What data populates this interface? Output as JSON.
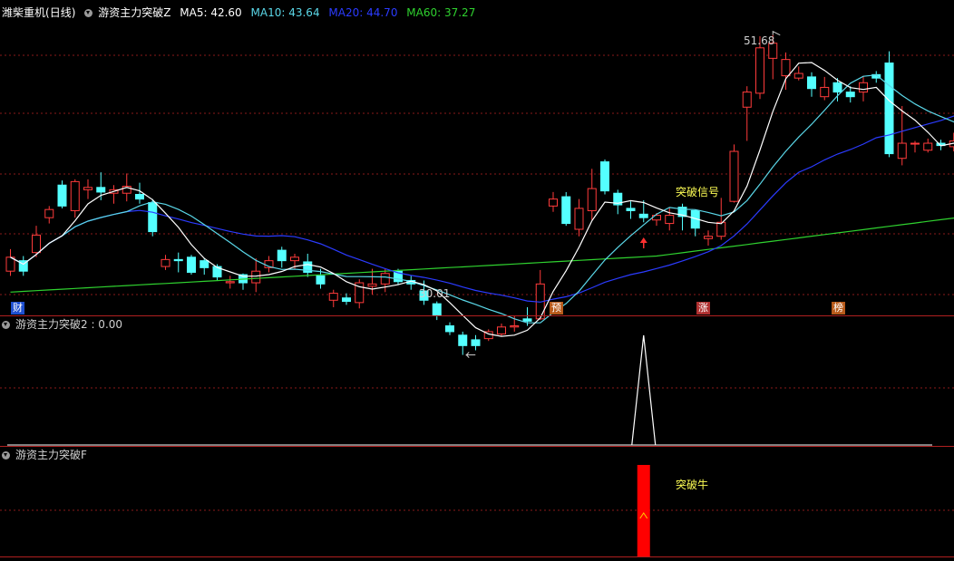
{
  "main_panel": {
    "stock": "潍柴重机",
    "period": "(日线)",
    "indicator": "游资主力突破Z",
    "ma": [
      {
        "label": "MA5: 42.60",
        "color": "#ffffff"
      },
      {
        "label": "MA10: 43.64",
        "color": "#5ad7e8"
      },
      {
        "label": "MA20: 44.70",
        "color": "#2b3bff"
      },
      {
        "label": "MA60: 37.27",
        "color": "#2fd12f"
      }
    ],
    "high_label": "51.68",
    "low_label": "30.01",
    "signal_label": "突破信号",
    "event_tags": [
      {
        "text": "财",
        "color": "#1e4fd0"
      },
      {
        "text": "预",
        "color": "#b85a1a"
      },
      {
        "text": "涨",
        "color": "#b03030"
      },
      {
        "text": "榜",
        "color": "#b85a1a"
      }
    ]
  },
  "sub_panel_1": {
    "title": "游资主力突破2 : 0.00"
  },
  "sub_panel_2": {
    "title": "游资主力突破F",
    "bull_label": "突破牛"
  },
  "colors": {
    "up": "#ff3b3b",
    "down": "#54ffff",
    "grid": "#8a1a1a"
  },
  "chart_data": {
    "type": "candlestick",
    "series": [
      {
        "name": "MA5",
        "values_note": "derived from candles"
      },
      {
        "name": "MA10"
      },
      {
        "name": "MA20"
      },
      {
        "name": "MA60"
      }
    ],
    "candles": [
      [
        31.4,
        32.6,
        33.3,
        31.0
      ],
      [
        32.3,
        31.4,
        32.7,
        31.0
      ],
      [
        33.0,
        34.5,
        35.3,
        32.6
      ],
      [
        36.0,
        36.7,
        37.0,
        35.5
      ],
      [
        38.8,
        37.0,
        39.2,
        36.8
      ],
      [
        36.6,
        39.1,
        39.3,
        36.0
      ],
      [
        38.4,
        38.6,
        39.3,
        37.6
      ],
      [
        38.6,
        38.2,
        39.9,
        37.5
      ],
      [
        38.1,
        38.4,
        38.8,
        37.2
      ],
      [
        38.1,
        38.7,
        39.8,
        37.4
      ],
      [
        38.0,
        37.6,
        39.0,
        37.2
      ],
      [
        37.3,
        34.8,
        37.6,
        34.4
      ],
      [
        31.8,
        32.4,
        32.8,
        31.5
      ],
      [
        32.4,
        32.3,
        33.0,
        31.3
      ],
      [
        32.6,
        31.3,
        32.8,
        31.1
      ],
      [
        32.3,
        31.7,
        32.5,
        31.1
      ],
      [
        31.8,
        30.9,
        32.0,
        30.6
      ],
      [
        30.4,
        30.5,
        31.0,
        29.9
      ],
      [
        31.1,
        30.4,
        31.2,
        29.8
      ],
      [
        30.4,
        31.4,
        32.5,
        29.6
      ],
      [
        31.7,
        32.3,
        32.7,
        31.3
      ],
      [
        33.2,
        32.3,
        33.5,
        31.7
      ],
      [
        32.3,
        32.6,
        32.9,
        31.6
      ],
      [
        32.2,
        31.3,
        32.9,
        30.9
      ],
      [
        31.0,
        30.3,
        31.6,
        29.9
      ],
      [
        28.9,
        29.5,
        29.8,
        28.3
      ],
      [
        29.1,
        28.8,
        29.5,
        28.5
      ],
      [
        28.7,
        30.4,
        30.7,
        28.2
      ],
      [
        30.1,
        30.3,
        31.6,
        29.4
      ],
      [
        30.3,
        31.2,
        31.6,
        29.6
      ],
      [
        31.4,
        30.5,
        31.6,
        30.2
      ],
      [
        30.6,
        30.3,
        31.0,
        29.8
      ],
      [
        29.7,
        28.9,
        30.6,
        28.5
      ],
      [
        28.6,
        27.6,
        28.8,
        27.2
      ],
      [
        26.7,
        26.2,
        27.0,
        25.9
      ],
      [
        25.9,
        25.0,
        26.2,
        24.2
      ],
      [
        25.5,
        25.0,
        25.9,
        24.6
      ],
      [
        25.6,
        26.2,
        26.4,
        25.4
      ],
      [
        26.0,
        26.6,
        26.9,
        25.8
      ],
      [
        26.6,
        26.7,
        27.6,
        26.2
      ],
      [
        27.3,
        27.1,
        28.3,
        26.7
      ],
      [
        27.3,
        30.3,
        31.5,
        27.2
      ],
      [
        37.0,
        37.6,
        38.2,
        36.5
      ],
      [
        37.8,
        35.5,
        38.2,
        35.3
      ],
      [
        35.0,
        36.8,
        37.6,
        34.4
      ],
      [
        36.6,
        38.5,
        40.2,
        35.8
      ],
      [
        40.8,
        38.3,
        41.0,
        38.0
      ],
      [
        38.1,
        37.1,
        38.4,
        36.3
      ],
      [
        36.8,
        36.6,
        37.4,
        35.9
      ],
      [
        36.3,
        36.0,
        37.5,
        35.6
      ],
      [
        35.8,
        36.2,
        36.4,
        35.3
      ],
      [
        35.5,
        36.2,
        36.9,
        34.9
      ],
      [
        36.9,
        36.1,
        37.2,
        34.9
      ],
      [
        36.6,
        35.1,
        36.7,
        34.4
      ],
      [
        34.2,
        34.4,
        34.9,
        33.6
      ],
      [
        34.4,
        35.6,
        37.7,
        34.1
      ],
      [
        37.4,
        41.7,
        42.3,
        37.3
      ],
      [
        45.5,
        46.8,
        47.3,
        42.6
      ],
      [
        46.7,
        50.6,
        51.6,
        46.2
      ],
      [
        49.7,
        51.0,
        51.7,
        47.9
      ],
      [
        48.2,
        49.6,
        50.2,
        47.0
      ],
      [
        48.0,
        48.4,
        49.0,
        47.8
      ],
      [
        48.1,
        47.1,
        48.5,
        46.4
      ],
      [
        46.4,
        47.2,
        48.1,
        46.1
      ],
      [
        47.6,
        46.8,
        48.0,
        46.0
      ],
      [
        46.8,
        46.4,
        47.3,
        45.9
      ],
      [
        46.8,
        47.6,
        48.2,
        46.0
      ],
      [
        48.3,
        48.0,
        48.6,
        47.6
      ],
      [
        49.3,
        41.5,
        50.3,
        41.2
      ],
      [
        41.1,
        42.4,
        45.6,
        40.5
      ],
      [
        42.4,
        42.4,
        42.6,
        41.6
      ],
      [
        41.8,
        42.4,
        42.8,
        41.6
      ],
      [
        42.4,
        42.2,
        42.7,
        41.8
      ],
      [
        42.1,
        42.6,
        43.3,
        41.7
      ],
      [
        42.9,
        40.5,
        43.1,
        40.2
      ],
      [
        40.6,
        41.3,
        41.8,
        40.5
      ]
    ],
    "high": 51.68,
    "low": 30.01,
    "ylim": [
      29.0,
      53.0
    ],
    "signal_index": 49
  }
}
